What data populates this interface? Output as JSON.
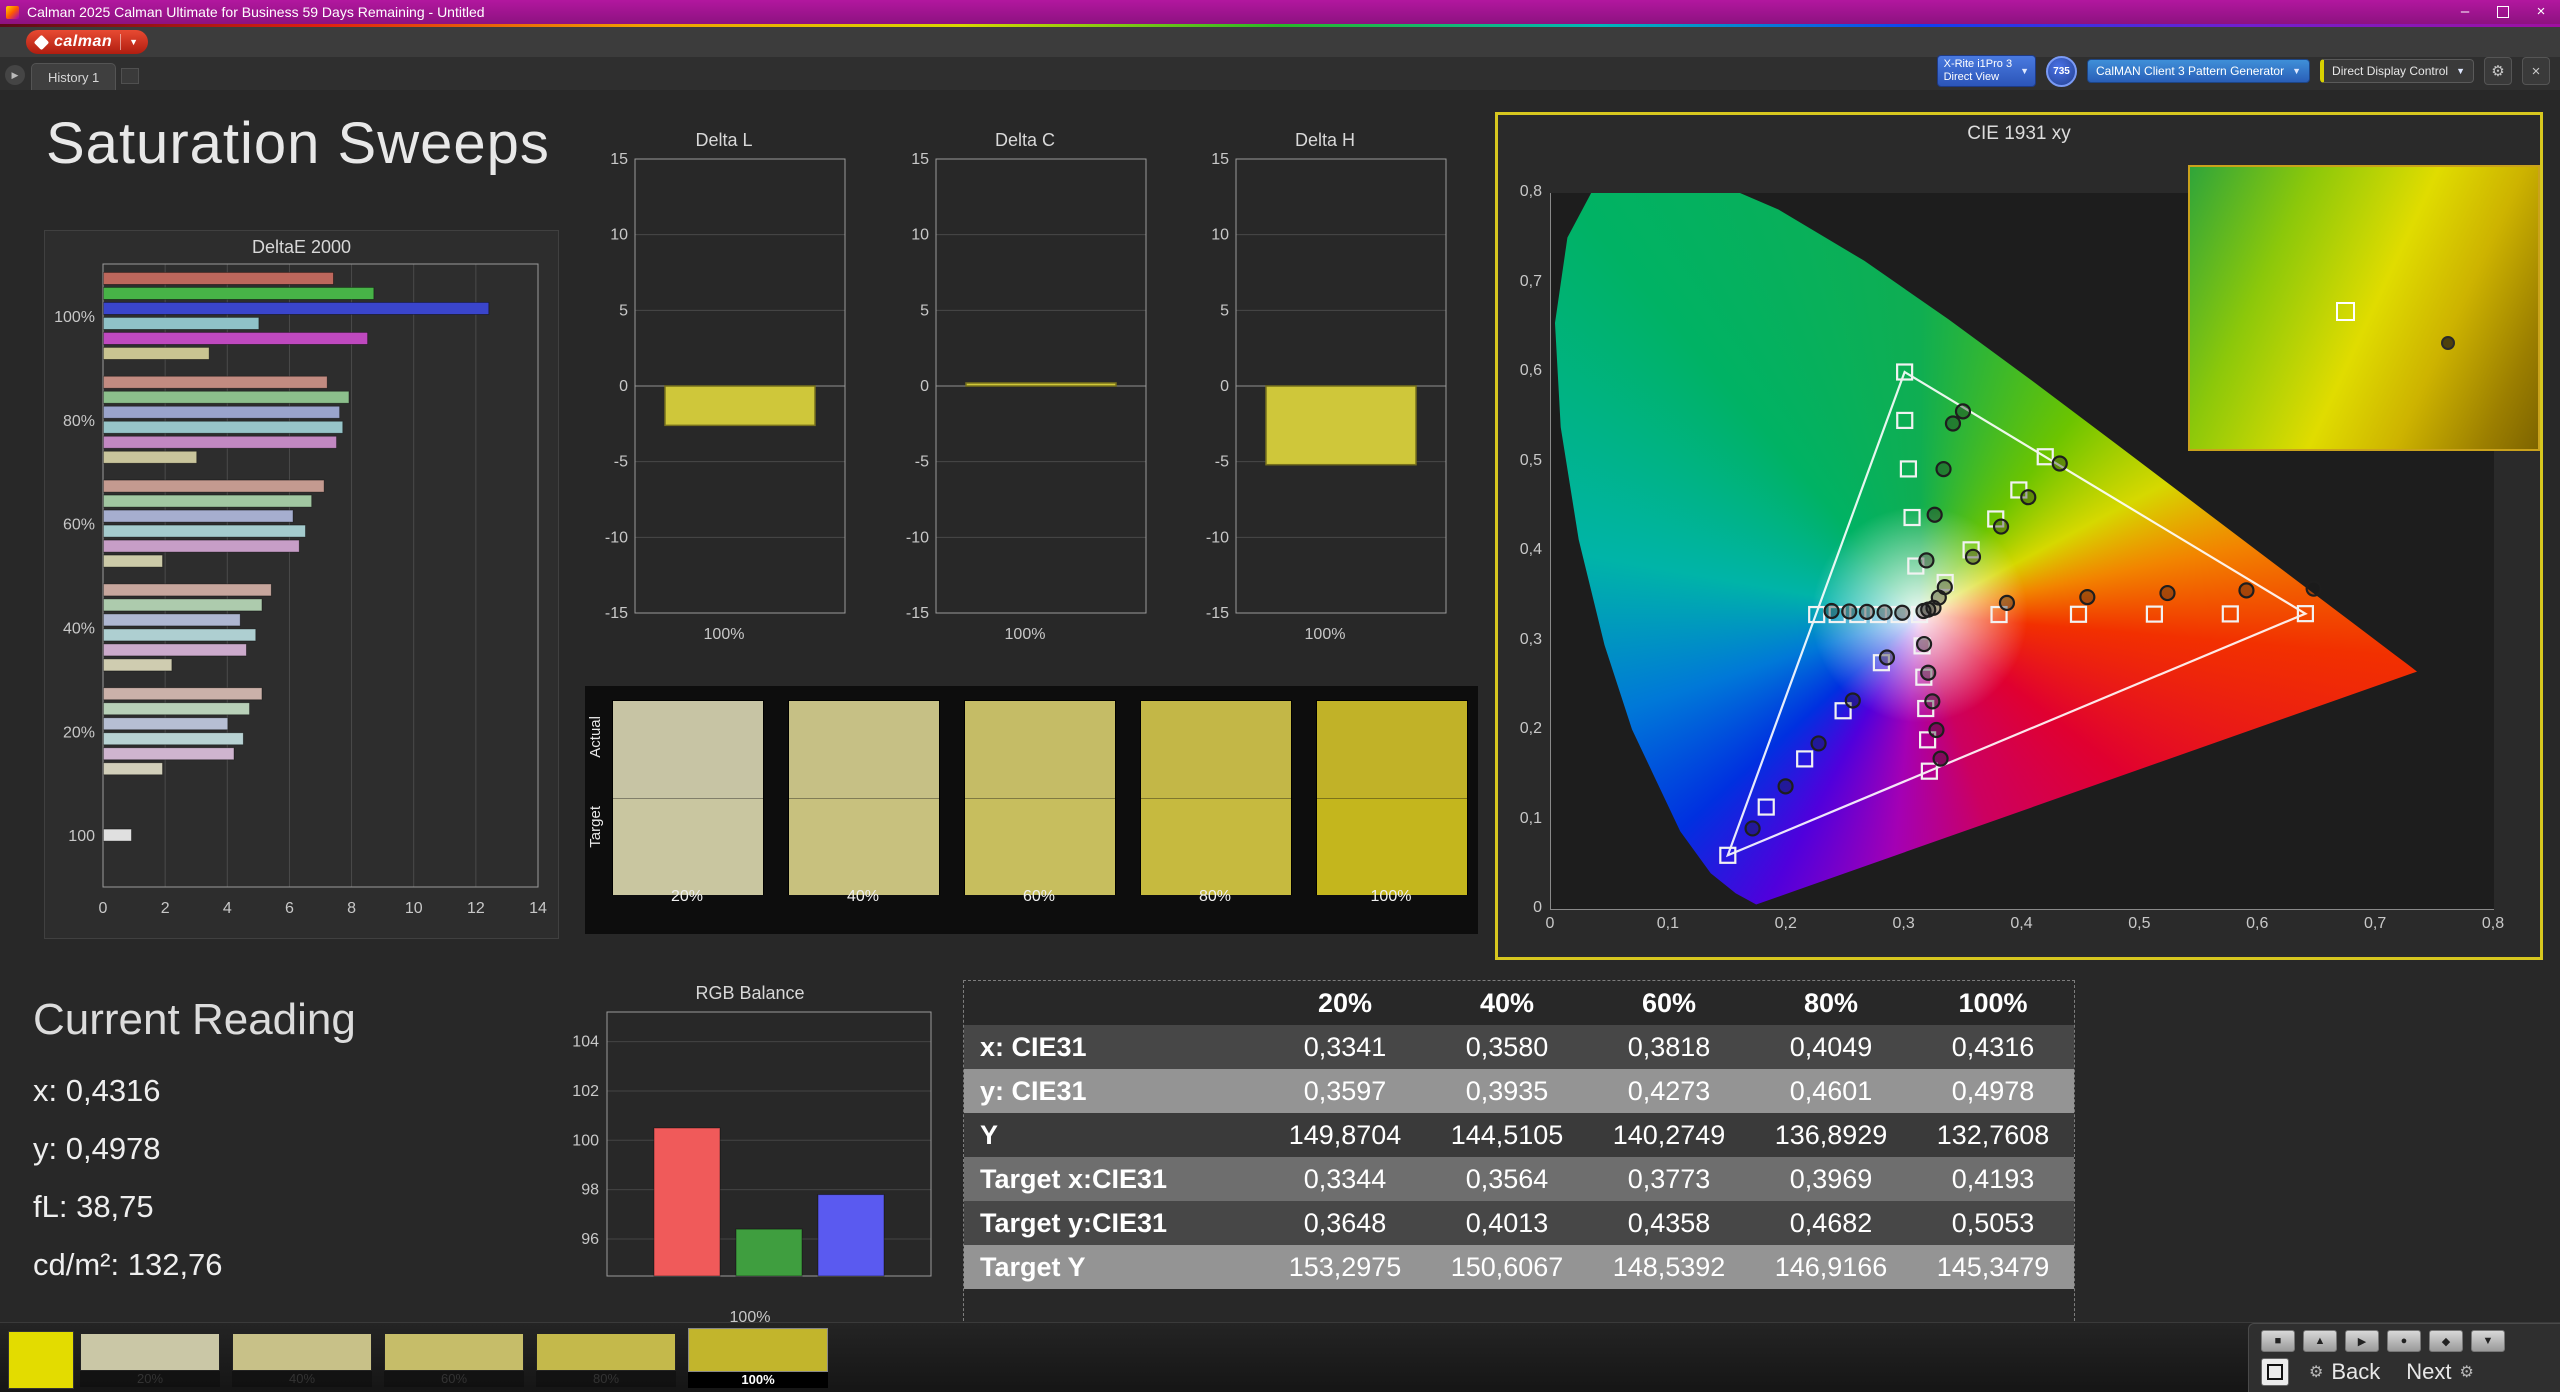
{
  "window": {
    "title": "Calman 2025 Calman Ultimate for Business 59 Days Remaining  - Untitled",
    "minimize": "–",
    "close": "×"
  },
  "logo": {
    "brand": "calman"
  },
  "tabs": {
    "history": "History 1"
  },
  "toolbar": {
    "meter_line1": "X-Rite i1Pro 3",
    "meter_line2": "Direct View",
    "meter_badge": "735",
    "pattern_generator": "CalMAN Client 3 Pattern Generator",
    "display_control": "Direct Display Control",
    "gear_glyph": "⚙",
    "close_glyph": "×"
  },
  "page": {
    "title": "Saturation Sweeps"
  },
  "current_reading": {
    "title": "Current Reading",
    "items": [
      {
        "label": "x:",
        "value": "0,4316"
      },
      {
        "label": "y:",
        "value": "0,4978"
      },
      {
        "label": "fL:",
        "value": "38,75"
      },
      {
        "label": "cd/m²:",
        "value": "132,76"
      }
    ]
  },
  "table": {
    "columns": [
      "20%",
      "40%",
      "60%",
      "80%",
      "100%"
    ],
    "rows": [
      {
        "label": "x: CIE31",
        "values": [
          "0,3341",
          "0,3580",
          "0,3818",
          "0,4049",
          "0,4316"
        ]
      },
      {
        "label": "y: CIE31",
        "values": [
          "0,3597",
          "0,3935",
          "0,4273",
          "0,4601",
          "0,4978"
        ]
      },
      {
        "label": "Y",
        "values": [
          "149,8704",
          "144,5105",
          "140,2749",
          "136,8929",
          "132,7608"
        ]
      },
      {
        "label": "Target x:CIE31",
        "values": [
          "0,3344",
          "0,3564",
          "0,3773",
          "0,3969",
          "0,4193"
        ]
      },
      {
        "label": "Target y:CIE31",
        "values": [
          "0,3648",
          "0,4013",
          "0,4358",
          "0,4682",
          "0,5053"
        ]
      },
      {
        "label": "Target Y",
        "values": [
          "153,2975",
          "150,6067",
          "148,5392",
          "146,9166",
          "145,3479"
        ]
      }
    ]
  },
  "saturation_swatches": {
    "row_labels": [
      "Actual",
      "Target"
    ],
    "columns": [
      {
        "label": "20%",
        "actual": "#c7c4a4",
        "target": "#c9c6a0"
      },
      {
        "label": "40%",
        "actual": "#c6c085",
        "target": "#c8c17e"
      },
      {
        "label": "60%",
        "actual": "#c5bc66",
        "target": "#c7be5e"
      },
      {
        "label": "80%",
        "actual": "#c3b747",
        "target": "#c6ba3f"
      },
      {
        "label": "100%",
        "actual": "#c1b228",
        "target": "#c4b61d"
      }
    ]
  },
  "bottom_bar": {
    "active_patch_color": "#e3dc00",
    "swatches": [
      {
        "label": "20%",
        "color": "#cac7a6"
      },
      {
        "label": "40%",
        "color": "#c8c188"
      },
      {
        "label": "60%",
        "color": "#c6bd69"
      },
      {
        "label": "80%",
        "color": "#c4b94b"
      },
      {
        "label": "100%",
        "color": "#c2b52c",
        "active": true
      }
    ],
    "icons": [
      {
        "name": "screen-icon",
        "glyph": "■"
      },
      {
        "name": "triangle-up-icon",
        "glyph": "▲"
      },
      {
        "name": "play-icon",
        "glyph": "▶"
      },
      {
        "name": "record-icon",
        "glyph": "●"
      },
      {
        "name": "marker-icon",
        "glyph": "◆"
      },
      {
        "name": "triangle-down-icon",
        "glyph": "▼"
      }
    ],
    "back_label": "Back",
    "next_label": "Next",
    "gear_glyph": "⚙"
  },
  "chart_data": {
    "deltae2000": {
      "type": "bar",
      "title": "DeltaE 2000",
      "xlim": [
        0,
        14
      ],
      "xticks": [
        0,
        2,
        4,
        6,
        8,
        10,
        12,
        14
      ],
      "groups": [
        {
          "label": "100%",
          "values": [
            7.4,
            8.7,
            12.4,
            5.0,
            8.5,
            3.4
          ],
          "colors": [
            "#bd675c",
            "#47b347",
            "#3a45cc",
            "#8fc2c8",
            "#bf49bf",
            "#c9c491"
          ]
        },
        {
          "label": "80%",
          "values": [
            7.2,
            7.9,
            7.6,
            7.7,
            7.5,
            3.0
          ],
          "colors": [
            "#c28b81",
            "#8cbf8c",
            "#9aa4cc",
            "#97c5c9",
            "#c288c2",
            "#c9c59c"
          ]
        },
        {
          "label": "60%",
          "values": [
            7.1,
            6.7,
            6.1,
            6.5,
            6.3,
            1.9
          ],
          "colors": [
            "#c49a90",
            "#a1c6a1",
            "#a6aecf",
            "#a4cbcd",
            "#c79ec7",
            "#cccaa8"
          ]
        },
        {
          "label": "40%",
          "values": [
            5.4,
            5.1,
            4.4,
            4.9,
            4.6,
            2.2
          ],
          "colors": [
            "#c7a69d",
            "#adcbad",
            "#aeb6d1",
            "#aecfd1",
            "#cbaacb",
            "#cfccb0"
          ]
        },
        {
          "label": "20%",
          "values": [
            5.1,
            4.7,
            4.0,
            4.5,
            4.2,
            1.9
          ],
          "colors": [
            "#cbb1a9",
            "#b8d0b8",
            "#b6bed3",
            "#b8d2d3",
            "#cfb4cf",
            "#d2cfba"
          ]
        },
        {
          "label": "100",
          "values": [
            0.9
          ],
          "colors": [
            "#e0e0e0"
          ]
        }
      ]
    },
    "delta_l": {
      "type": "bar",
      "title": "Delta L",
      "categories": [
        "100%"
      ],
      "values": [
        -2.6
      ],
      "ylim": [
        -15,
        15
      ],
      "yticks": [
        15,
        10,
        5,
        0,
        -5,
        -10,
        -15
      ],
      "bar_color": "#cfc73a"
    },
    "delta_c": {
      "type": "bar",
      "title": "Delta C",
      "categories": [
        "100%"
      ],
      "values": [
        0.2
      ],
      "ylim": [
        -15,
        15
      ],
      "yticks": [
        15,
        10,
        5,
        0,
        -5,
        -10,
        -15
      ],
      "bar_color": "#cfc73a"
    },
    "delta_h": {
      "type": "bar",
      "title": "Delta H",
      "categories": [
        "100%"
      ],
      "values": [
        -5.2
      ],
      "ylim": [
        -15,
        15
      ],
      "yticks": [
        15,
        10,
        5,
        0,
        -5,
        -10,
        -15
      ],
      "bar_color": "#cfc73a"
    },
    "rgb_balance": {
      "type": "bar",
      "title": "RGB Balance",
      "xlabel": "100%",
      "categories": [
        "Red",
        "Green",
        "Blue"
      ],
      "values": [
        100.5,
        96.4,
        97.8
      ],
      "colors": [
        "#f05a5a",
        "#3f9e3f",
        "#5a5af0"
      ],
      "ylim": [
        94.5,
        105.2
      ],
      "yticks": [
        104,
        102,
        100,
        98,
        96
      ]
    },
    "cie1931": {
      "type": "scatter",
      "title": "CIE 1931 xy",
      "xlim": [
        0,
        0.8
      ],
      "ylim": [
        0,
        0.8
      ],
      "xticks": [
        "0",
        "0,1",
        "0,2",
        "0,3",
        "0,4",
        "0,5",
        "0,6",
        "0,7",
        "0,8"
      ],
      "yticks": [
        "0,8",
        "0,7",
        "0,6",
        "0,5",
        "0,4",
        "0,3",
        "0,2",
        "0,1",
        "0"
      ],
      "gamut_triangle": [
        [
          0.64,
          0.33
        ],
        [
          0.3,
          0.6
        ],
        [
          0.15,
          0.06
        ]
      ],
      "white_point": [
        0.3127,
        0.329
      ],
      "spectral_locus": [
        [
          0.1741,
          0.005
        ],
        [
          0.1566,
          0.0177
        ],
        [
          0.1355,
          0.0399
        ],
        [
          0.1096,
          0.0868
        ],
        [
          0.0687,
          0.2007
        ],
        [
          0.0454,
          0.295
        ],
        [
          0.0235,
          0.4127
        ],
        [
          0.0082,
          0.5384
        ],
        [
          0.0034,
          0.6548
        ],
        [
          0.0139,
          0.7502
        ],
        [
          0.0389,
          0.812
        ],
        [
          0.0743,
          0.8338
        ],
        [
          0.1142,
          0.8262
        ],
        [
          0.1929,
          0.7816
        ],
        [
          0.2658,
          0.7243
        ],
        [
          0.3373,
          0.6588
        ],
        [
          0.4087,
          0.5896
        ],
        [
          0.4788,
          0.5202
        ],
        [
          0.5448,
          0.4544
        ],
        [
          0.6029,
          0.3965
        ],
        [
          0.6482,
          0.3514
        ],
        [
          0.6801,
          0.3197
        ],
        [
          0.7006,
          0.2993
        ],
        [
          0.714,
          0.2859
        ],
        [
          0.726,
          0.274
        ],
        [
          0.7347,
          0.2653
        ]
      ],
      "targets": [
        [
          0.3127,
          0.329
        ],
        [
          0.3344,
          0.3648
        ],
        [
          0.3564,
          0.4013
        ],
        [
          0.3773,
          0.4358
        ],
        [
          0.3969,
          0.4682
        ],
        [
          0.4193,
          0.5053
        ],
        [
          0.3801,
          0.329
        ],
        [
          0.4475,
          0.3293
        ],
        [
          0.5119,
          0.3295
        ],
        [
          0.5763,
          0.3297
        ],
        [
          0.64,
          0.33
        ],
        [
          0.3095,
          0.3832
        ],
        [
          0.3063,
          0.4374
        ],
        [
          0.3032,
          0.4917
        ],
        [
          0.3001,
          0.5459
        ],
        [
          0.3,
          0.6
        ],
        [
          0.2803,
          0.2752
        ],
        [
          0.2478,
          0.2215
        ],
        [
          0.2152,
          0.1677
        ],
        [
          0.1826,
          0.1139
        ],
        [
          0.15,
          0.06
        ],
        [
          0.2953,
          0.329
        ],
        [
          0.2778,
          0.329
        ],
        [
          0.2603,
          0.329
        ],
        [
          0.2428,
          0.329
        ],
        [
          0.2254,
          0.329
        ],
        [
          0.3148,
          0.294
        ],
        [
          0.3163,
          0.259
        ],
        [
          0.3179,
          0.224
        ],
        [
          0.3195,
          0.189
        ],
        [
          0.321,
          0.154
        ]
      ],
      "measured": [
        [
          0.3341,
          0.3597
        ],
        [
          0.358,
          0.3935
        ],
        [
          0.3818,
          0.4273
        ],
        [
          0.4049,
          0.4601
        ],
        [
          0.4316,
          0.4978
        ],
        [
          0.3868,
          0.342
        ],
        [
          0.455,
          0.3485
        ],
        [
          0.523,
          0.353
        ],
        [
          0.59,
          0.356
        ],
        [
          0.647,
          0.358
        ],
        [
          0.3185,
          0.3895
        ],
        [
          0.3255,
          0.4405
        ],
        [
          0.333,
          0.4915
        ],
        [
          0.341,
          0.5425
        ],
        [
          0.3495,
          0.556
        ],
        [
          0.285,
          0.281
        ],
        [
          0.256,
          0.233
        ],
        [
          0.227,
          0.185
        ],
        [
          0.199,
          0.137
        ],
        [
          0.171,
          0.09
        ],
        [
          0.298,
          0.331
        ],
        [
          0.283,
          0.3315
        ],
        [
          0.268,
          0.332
        ],
        [
          0.253,
          0.3325
        ],
        [
          0.238,
          0.333
        ],
        [
          0.3165,
          0.296
        ],
        [
          0.32,
          0.264
        ],
        [
          0.3235,
          0.232
        ],
        [
          0.327,
          0.2
        ],
        [
          0.3305,
          0.168
        ],
        [
          0.316,
          0.333
        ],
        [
          0.32,
          0.3345
        ],
        [
          0.3245,
          0.3365
        ],
        [
          0.329,
          0.348
        ]
      ]
    }
  }
}
